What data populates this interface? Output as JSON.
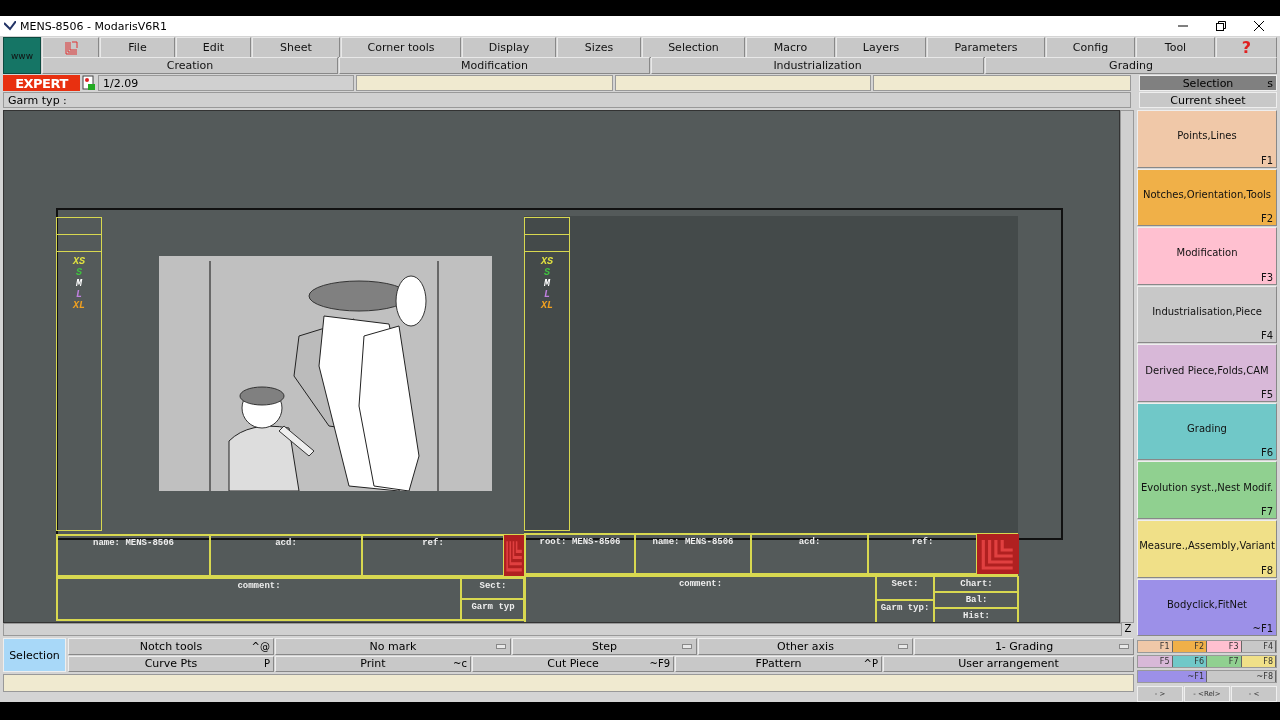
{
  "window": {
    "title": "MENS-8506 - ModarisV6R1"
  },
  "logo": "www",
  "menu": [
    "File",
    "Edit",
    "Sheet",
    "Corner tools",
    "Display",
    "Sizes",
    "Selection",
    "Macro",
    "Layers",
    "Parameters",
    "Config",
    "Tool"
  ],
  "help": "?",
  "sections": [
    "Creation",
    "Modification",
    "Industrialization",
    "Grading"
  ],
  "edition": "EXPERT",
  "version": "1/2.09",
  "garm_label": "Garm typ :",
  "side_header": {
    "selection": "Selection",
    "shortcut": "s",
    "current": "Current sheet"
  },
  "functions": [
    {
      "label": "Points,Lines",
      "key": "F1",
      "color": "#f0c8a8"
    },
    {
      "label": "Notches,Orientation,Tools",
      "key": "F2",
      "color": "#f0b048"
    },
    {
      "label": "Modification",
      "key": "F3",
      "color": "#ffc0d0"
    },
    {
      "label": "Industrialisation,Piece",
      "key": "F4",
      "color": "#c8c8c8"
    },
    {
      "label": "Derived Piece,Folds,CAM",
      "key": "F5",
      "color": "#d8b8d8"
    },
    {
      "label": "Grading",
      "key": "F6",
      "color": "#70c8c8"
    },
    {
      "label": "Evolution syst.,Nest Modif.",
      "key": "F7",
      "color": "#90d090"
    },
    {
      "label": "Measure.,Assembly,Variant",
      "key": "F8",
      "color": "#f0e088"
    },
    {
      "label": "Bodyclick,FitNet",
      "key": "~F1",
      "color": "#9c90e8"
    }
  ],
  "key_strips": [
    [
      {
        "key": "F1",
        "color": "#f0c8a8"
      },
      {
        "key": "F2",
        "color": "#f0b048"
      },
      {
        "key": "F3",
        "color": "#ffc0d0"
      },
      {
        "key": "F4",
        "color": "#c8c8c8"
      }
    ],
    [
      {
        "key": "F5",
        "color": "#d8b8d8"
      },
      {
        "key": "F6",
        "color": "#70c8c8"
      },
      {
        "key": "F7",
        "color": "#90d090"
      },
      {
        "key": "F8",
        "color": "#f0e088"
      }
    ],
    [
      {
        "key": "~F1",
        "color": "#9c90e8"
      },
      {
        "key": "~F8",
        "color": "#c8c8c8"
      }
    ]
  ],
  "nav_buttons": [
    "- >",
    "- <Rel>",
    "- <"
  ],
  "left_sheet": {
    "sizes": [
      {
        "label": "XS",
        "color": "#e0e040"
      },
      {
        "label": "S",
        "color": "#40c040"
      },
      {
        "label": "M",
        "color": "#ffffff"
      },
      {
        "label": "L",
        "color": "#c080e0"
      },
      {
        "label": "XL",
        "color": "#f0a020"
      }
    ],
    "fields": [
      "name: MENS-8506",
      "acd:",
      "ref:"
    ],
    "comment": "comment:",
    "side": [
      "Sect:",
      "Garm typ"
    ]
  },
  "right_sheet": {
    "sizes": [
      {
        "label": "XS",
        "color": "#e0e040"
      },
      {
        "label": "S",
        "color": "#40c040"
      },
      {
        "label": "M",
        "color": "#ffffff"
      },
      {
        "label": "L",
        "color": "#c080e0"
      },
      {
        "label": "XL",
        "color": "#f0a020"
      }
    ],
    "fields": [
      "root: MENS-8506",
      "name: MENS-8506",
      "acd:",
      "ref:"
    ],
    "comment": "comment:",
    "side": [
      "Sect:",
      "Garm typ:"
    ],
    "extra": [
      "Chart:",
      "Bal:",
      "Hist:"
    ]
  },
  "scroll_corner": "Z",
  "mode_button": {
    "label": "Selection",
    "selected": true
  },
  "tools": [
    [
      {
        "label": "Notch tools",
        "shortcut": "^@",
        "dropdown": false
      },
      {
        "label": "No mark",
        "dropdown": true
      },
      {
        "label": "Step",
        "dropdown": true
      },
      {
        "label": "Other axis",
        "dropdown": true
      },
      {
        "label": "1- Grading",
        "dropdown": true
      }
    ],
    [
      {
        "label": "Curve Pts",
        "shortcut": "P",
        "dropdown": false
      },
      {
        "label": "Print",
        "shortcut": "~c",
        "dropdown": false
      },
      {
        "label": "Cut Piece",
        "shortcut": "~F9",
        "dropdown": false
      },
      {
        "label": "FPattern",
        "shortcut": "^P",
        "dropdown": false
      },
      {
        "label": "User arrangement",
        "dropdown": false
      }
    ]
  ]
}
